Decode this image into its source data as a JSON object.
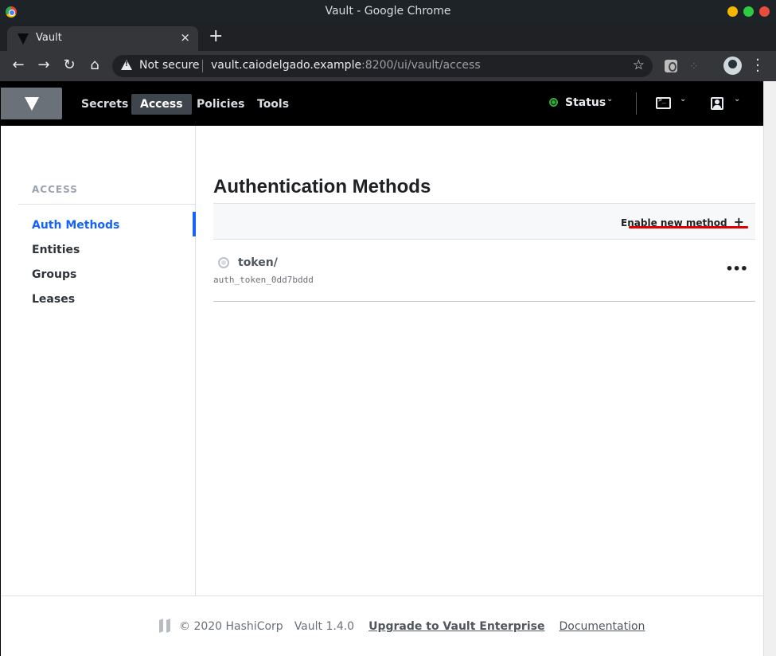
{
  "window": {
    "title": "Vault - Google Chrome"
  },
  "browser": {
    "tab_title": "Vault",
    "tab_close": "×",
    "new_tab": "+",
    "security_label": "Not secure",
    "url_host": "vault.caiodelgado.example",
    "url_rest": ":8200/ui/vault/access",
    "star": "☆"
  },
  "vault_nav": {
    "links": [
      "Secrets",
      "Access",
      "Policies",
      "Tools"
    ],
    "active": "Access",
    "status_label": "Status",
    "chevron": "⌄"
  },
  "sidebar": {
    "heading": "ACCESS",
    "items": [
      {
        "label": "Auth Methods",
        "active": true
      },
      {
        "label": "Entities",
        "active": false
      },
      {
        "label": "Groups",
        "active": false
      },
      {
        "label": "Leases",
        "active": false
      }
    ]
  },
  "main": {
    "title": "Authentication Methods",
    "enable_button": "Enable new method",
    "enable_plus": "+",
    "methods": [
      {
        "path": "token/",
        "accessor": "auth_token_0dd7bddd",
        "menu": "•••"
      }
    ]
  },
  "footer": {
    "copyright": "© 2020 HashiCorp",
    "version": "Vault 1.4.0",
    "upgrade": "Upgrade to Vault Enterprise",
    "docs": "Documentation"
  },
  "colors": {
    "accent": "#1563ff",
    "status_ok": "#2eb039",
    "annotation": "#e00000"
  }
}
